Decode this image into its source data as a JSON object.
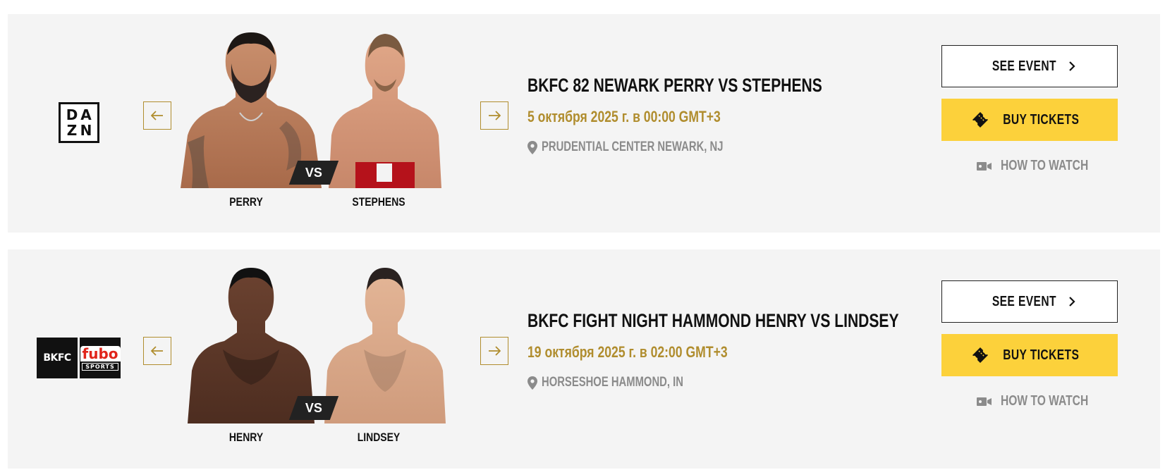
{
  "events": [
    {
      "broadcasters": [
        "DAZN"
      ],
      "title": "BKFC 82 NEWARK PERRY VS STEPHENS",
      "date": "5 октября 2025 г. в 00:00 GMT+3",
      "venue": "PRUDENTIAL CENTER NEWARK, NJ",
      "fighter_left": "PERRY",
      "fighter_right": "STEPHENS",
      "vs": "VS",
      "see_event": "SEE EVENT",
      "buy_tickets": "BUY TICKETS",
      "how_to_watch": "HOW TO WATCH"
    },
    {
      "broadcasters": [
        "BKFC",
        "fubo SPORTS"
      ],
      "bkfc_logo": "BKFC",
      "fubo_logo": "fubo",
      "fubo_sub": "SPORTS",
      "title": "BKFC FIGHT NIGHT HAMMOND HENRY VS LINDSEY",
      "date": "19 октября 2025 г. в 02:00 GMT+3",
      "venue": "HORSESHOE HAMMOND, IN",
      "fighter_left": "HENRY",
      "fighter_right": "LINDSEY",
      "vs": "VS",
      "see_event": "SEE EVENT",
      "buy_tickets": "BUY TICKETS",
      "how_to_watch": "HOW TO WATCH"
    }
  ],
  "dazn_letters": [
    "D",
    "A",
    "Z",
    "N"
  ],
  "colors": {
    "accent_gold": "#b08d2e",
    "ticket_yellow": "#fcd13b",
    "card_bg": "#f4f4f4",
    "muted_text": "#8b8b8b"
  },
  "icons": [
    "arrow-left-icon",
    "arrow-right-icon",
    "location-pin-icon",
    "chevron-right-icon",
    "ticket-icon",
    "video-camera-icon"
  ]
}
